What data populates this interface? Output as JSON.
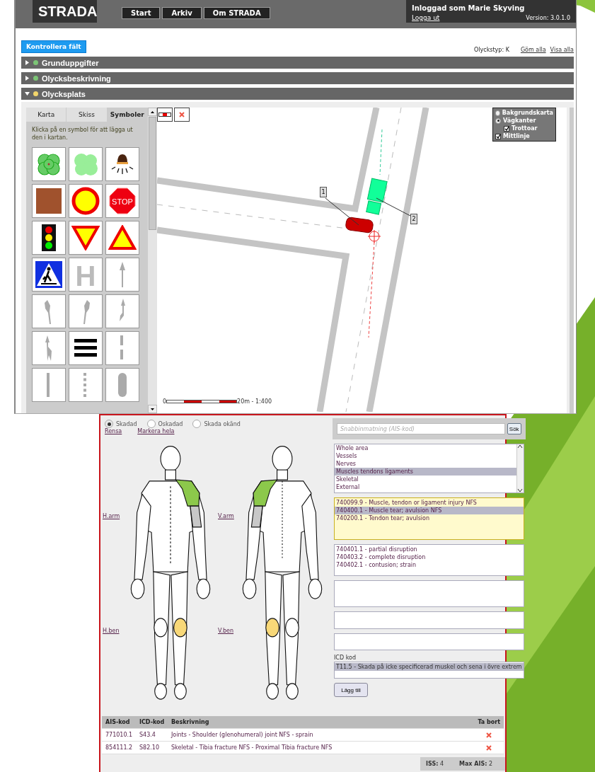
{
  "app": {
    "logo": "STRADA",
    "nav": [
      {
        "label": "Start"
      },
      {
        "label": "Arkiv"
      },
      {
        "label": "Om STRADA"
      }
    ],
    "user": "Inloggad som Marie Skyving",
    "logout": "Logga ut",
    "version": "Version: 3.0.1.0"
  },
  "toolbar": {
    "check_button": "Kontrollera fält",
    "accident_type": "Olyckstyp: K",
    "hide_all": "Göm alla",
    "show_all": "Visa alla"
  },
  "sections": [
    {
      "title": "Grunduppgifter",
      "expanded": false,
      "color": "#7cc576"
    },
    {
      "title": "Olycksbeskrivning",
      "expanded": false,
      "color": "#7cc576"
    },
    {
      "title": "Olycksplats",
      "expanded": true,
      "color": "#f2d56b"
    }
  ],
  "symbol_panel": {
    "tabs": [
      {
        "label": "Karta",
        "selected": false
      },
      {
        "label": "Skiss",
        "selected": false
      },
      {
        "label": "Symboler",
        "selected": true
      }
    ],
    "hint": "Klicka på en symbol för att lägga ut den i kartan.",
    "symbols": [
      {
        "kind": "bush"
      },
      {
        "kind": "shrub"
      },
      {
        "kind": "lamp"
      },
      {
        "kind": "square"
      },
      {
        "kind": "ring-sign"
      },
      {
        "kind": "stop",
        "text": "STOP"
      },
      {
        "kind": "traffic-light"
      },
      {
        "kind": "yield"
      },
      {
        "kind": "warning"
      },
      {
        "kind": "crossing"
      },
      {
        "kind": "letter",
        "text": "H"
      },
      {
        "kind": "arrow-up"
      },
      {
        "kind": "arrow-left"
      },
      {
        "kind": "arrow-right"
      },
      {
        "kind": "arrow-split"
      },
      {
        "kind": "arrow-split-down"
      },
      {
        "kind": "bars"
      },
      {
        "kind": "dash-short"
      },
      {
        "kind": "line-solid"
      },
      {
        "kind": "line-dashed"
      },
      {
        "kind": "pill"
      }
    ]
  },
  "map": {
    "tools": [
      {
        "kind": "barrier"
      },
      {
        "kind": "delete"
      }
    ],
    "layers": [
      {
        "label": "Bakgrundskarta",
        "kind": "radio",
        "selected": false
      },
      {
        "label": "Vägkanter",
        "kind": "radio",
        "selected": true,
        "children": [
          {
            "label": "Trottoar",
            "kind": "check",
            "checked": true
          }
        ]
      },
      {
        "label": "Mittlinje",
        "kind": "check",
        "checked": true
      }
    ],
    "markers": [
      "1",
      "2"
    ],
    "scale_start": "0",
    "scale_end": "20m - 1:400"
  },
  "injury": {
    "status_options": [
      {
        "label": "Skadad",
        "selected": true
      },
      {
        "label": "Oskadad",
        "selected": false
      },
      {
        "label": "Skada okänd",
        "selected": false
      }
    ],
    "clear_link": "Rensa",
    "mark_all_link": "Markera hela",
    "body_links": [
      "H.arm",
      "V.arm",
      "H.ben",
      "V.ben"
    ],
    "highlights": [
      {
        "kind": "shoulder",
        "color": "#8cc84b"
      },
      {
        "kind": "upper-arm",
        "color": "#c8c8c8"
      },
      {
        "kind": "knee",
        "color": "#f8d878"
      }
    ],
    "search": {
      "placeholder": "Snabbinmatning (AIS-kod)",
      "button": "Sök"
    },
    "categories": [
      {
        "label": "Whole area",
        "selected": false
      },
      {
        "label": "Vessels",
        "selected": false
      },
      {
        "label": "Nerves",
        "selected": false
      },
      {
        "label": "Muscles tendons ligaments",
        "selected": true
      },
      {
        "label": "Skeletal",
        "selected": false
      },
      {
        "label": "External",
        "selected": false
      }
    ],
    "codes": [
      {
        "label": "740099.9 - Muscle, tendon or ligament injury NFS",
        "selected": false
      },
      {
        "label": "740400.1 - Muscle tear; avulsion NFS",
        "selected": true
      },
      {
        "label": "740200.1 - Tendon tear; avulsion",
        "selected": false
      }
    ],
    "subcodes": [
      "740401.1 - partial disruption",
      "740403.2 - complete disruption",
      "740402.1 - contusion; strain"
    ],
    "icd_label": "ICD kod",
    "icd_value": "T11.5 - Skada på icke specificerad muskel och sena i övre extrem",
    "add_button": "Lägg till"
  },
  "table": {
    "columns": [
      "AIS-kod",
      "ICD-kod",
      "Beskrivning",
      "Ta bort"
    ],
    "rows": [
      [
        "771010.1",
        "S43.4",
        "Joints - Shoulder (glenohumeral) joint NFS - sprain"
      ],
      [
        "854111.2",
        "S82.10",
        "Skeletal - Tibia fracture NFS - Proximal Tibia fracture NFS"
      ]
    ]
  },
  "totals": [
    {
      "label": "ISS:",
      "value": "4"
    },
    {
      "label": "Max AIS:",
      "value": "2"
    }
  ]
}
